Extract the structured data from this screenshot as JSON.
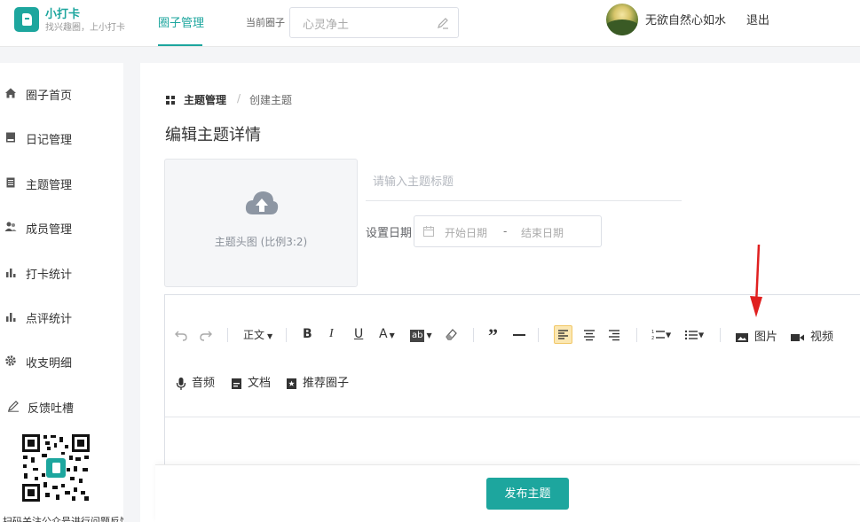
{
  "brand": {
    "name": "小打卡",
    "tagline": "找兴趣圈，上小打卡",
    "accent": "#1da69e"
  },
  "nav": {
    "active_tab": "圈子管理"
  },
  "circle_selector": {
    "label": "当前圈子",
    "value": "心灵净土"
  },
  "user": {
    "name": "无欲自然心如水",
    "logout": "退出"
  },
  "sidebar": {
    "items": [
      {
        "label": "圈子首页",
        "icon": "home-icon"
      },
      {
        "label": "日记管理",
        "icon": "book-icon"
      },
      {
        "label": "主题管理",
        "icon": "document-icon"
      },
      {
        "label": "成员管理",
        "icon": "members-icon"
      },
      {
        "label": "打卡统计",
        "icon": "bar-chart-icon"
      },
      {
        "label": "点评统计",
        "icon": "bar-chart-icon"
      },
      {
        "label": "收支明细",
        "icon": "gear-icon"
      },
      {
        "label": "反馈吐槽",
        "icon": "pen-icon"
      }
    ],
    "qr_caption": "扫码关注公众号进行问题反馈"
  },
  "breadcrumb": {
    "parent": "主题管理",
    "separator": "/",
    "current": "创建主题"
  },
  "page": {
    "title": "编辑主题详情"
  },
  "form": {
    "cover_label": "主题头图 (比例3:2)",
    "title_placeholder": "请输入主题标题",
    "date_label": "设置日期",
    "date_start_placeholder": "开始日期",
    "date_separator": "-",
    "date_end_placeholder": "结束日期"
  },
  "editor_toolbar": {
    "format_select": "正文",
    "image_label": "图片",
    "video_label": "视频",
    "audio_label": "音频",
    "doc_label": "文档",
    "recommend_label": "推荐圈子"
  },
  "actions": {
    "publish": "发布主题"
  }
}
